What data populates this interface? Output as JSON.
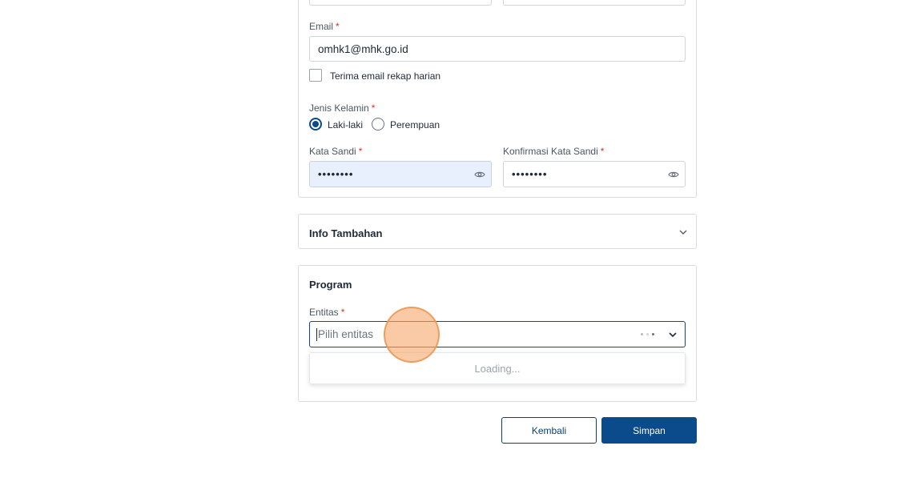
{
  "account": {
    "email_label": "Email",
    "email_value": "omhk1@mhk.go.id",
    "daily_recap_label": "Terima email rekap harian",
    "gender_label": "Jenis Kelamin",
    "gender_options": [
      "Laki-laki",
      "Perempuan"
    ],
    "gender_selected": "Laki-laki",
    "password_label": "Kata Sandi",
    "password_value": "••••••••",
    "confirm_password_label": "Konfirmasi Kata Sandi",
    "confirm_password_value": "••••••••",
    "required_mark": "*"
  },
  "info_tambahan": {
    "title": "Info Tambahan"
  },
  "program": {
    "title": "Program",
    "entitas_label": "Entitas",
    "entitas_placeholder": "Pilih entitas",
    "dropdown_status": "Loading..."
  },
  "actions": {
    "back_label": "Kembali",
    "save_label": "Simpan"
  },
  "colors": {
    "primary": "#0b4a8b",
    "required": "#d93025",
    "autofill_bg": "#e8f0fe"
  }
}
